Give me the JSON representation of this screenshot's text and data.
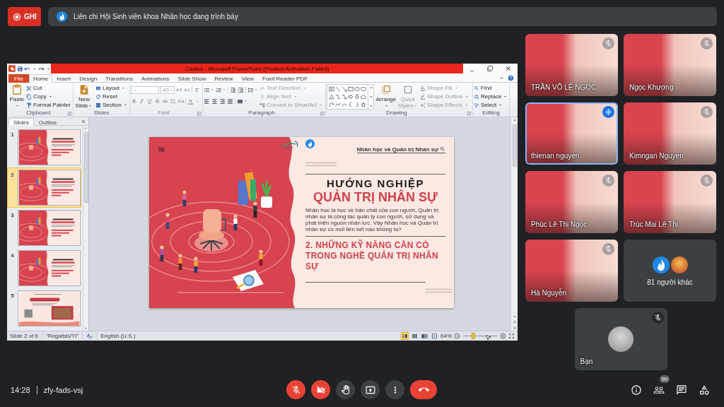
{
  "recording": {
    "label": "GHI"
  },
  "presenter_banner": {
    "text": "Liên chi Hội Sinh viên khoa Nhân học đang trình bày"
  },
  "powerpoint": {
    "title": "Cauhoi - Microsoft PowerPoint (Product Activation Failed)",
    "tabs": [
      {
        "label": "File",
        "kind": "file",
        "selected": false
      },
      {
        "label": "Home",
        "kind": "tab",
        "selected": true
      },
      {
        "label": "Insert",
        "kind": "tab",
        "selected": false
      },
      {
        "label": "Design",
        "kind": "tab",
        "selected": false
      },
      {
        "label": "Transitions",
        "kind": "tab",
        "selected": false
      },
      {
        "label": "Animations",
        "kind": "tab",
        "selected": false
      },
      {
        "label": "Slide Show",
        "kind": "tab",
        "selected": false
      },
      {
        "label": "Review",
        "kind": "tab",
        "selected": false
      },
      {
        "label": "View",
        "kind": "tab",
        "selected": false
      },
      {
        "label": "Foxit Reader PDF",
        "kind": "tab",
        "selected": false
      }
    ],
    "ribbon": {
      "groups": [
        {
          "label": "Clipboard",
          "launcher": true,
          "disabled": false,
          "columns": [
            {
              "kind": "large",
              "buttons": [
                {
                  "label": "Paste",
                  "dropdown": true,
                  "disabled": false
                }
              ]
            },
            {
              "kind": "stack",
              "buttons": [
                {
                  "label": "Cut",
                  "dropdown": false,
                  "disabled": false
                },
                {
                  "label": "Copy",
                  "dropdown": true,
                  "disabled": false
                },
                {
                  "label": "Format Painter",
                  "dropdown": false,
                  "disabled": false
                }
              ]
            }
          ]
        },
        {
          "label": "Slides",
          "launcher": false,
          "disabled": false,
          "columns": [
            {
              "kind": "large",
              "buttons": [
                {
                  "label": "New Slide",
                  "dropdown": true,
                  "disabled": false
                }
              ]
            },
            {
              "kind": "stack",
              "buttons": [
                {
                  "label": "Layout",
                  "dropdown": true,
                  "disabled": false
                },
                {
                  "label": "Reset",
                  "dropdown": false,
                  "disabled": false
                },
                {
                  "label": "Section",
                  "dropdown": true,
                  "disabled": false
                }
              ]
            }
          ]
        },
        {
          "label": "Font",
          "launcher": true,
          "disabled": true,
          "columns": [
            {
              "kind": "font",
              "size": "40"
            }
          ]
        },
        {
          "label": "Paragraph",
          "launcher": true,
          "disabled": false,
          "columns": [
            {
              "kind": "paragraph"
            },
            {
              "kind": "stack",
              "buttons": [
                {
                  "label": "Text Direction",
                  "dropdown": true,
                  "disabled": true
                },
                {
                  "label": "Align Text",
                  "dropdown": true,
                  "disabled": true
                },
                {
                  "label": "Convert to SmartArt",
                  "dropdown": true,
                  "disabled": true
                }
              ]
            }
          ]
        },
        {
          "label": "Drawing",
          "launcher": true,
          "disabled": false,
          "columns": [
            {
              "kind": "shapes"
            },
            {
              "kind": "large",
              "buttons": [
                {
                  "label": "Arrange",
                  "dropdown": true,
                  "disabled": false
                },
                {
                  "label": "Quick Styles",
                  "dropdown": true,
                  "disabled": true
                }
              ]
            },
            {
              "kind": "stack",
              "buttons": [
                {
                  "label": "Shape Fill",
                  "dropdown": true,
                  "disabled": true
                },
                {
                  "label": "Shape Outline",
                  "dropdown": true,
                  "disabled": true
                },
                {
                  "label": "Shape Effects",
                  "dropdown": true,
                  "disabled": true
                }
              ]
            }
          ]
        },
        {
          "label": "Editing",
          "launcher": false,
          "disabled": false,
          "columns": [
            {
              "kind": "stack",
              "buttons": [
                {
                  "label": "Find",
                  "dropdown": false,
                  "disabled": false
                },
                {
                  "label": "Replace",
                  "dropdown": true,
                  "disabled": false
                },
                {
                  "label": "Select",
                  "dropdown": true,
                  "disabled": false
                }
              ]
            }
          ]
        }
      ]
    },
    "slides_pane": {
      "tabs": [
        {
          "label": "Slides",
          "selected": true
        },
        {
          "label": "Outline",
          "selected": false
        }
      ],
      "thumbnails": [
        {
          "number": "1",
          "kind": "title",
          "selected": false
        },
        {
          "number": "2",
          "kind": "title",
          "selected": true
        },
        {
          "number": "3",
          "kind": "title",
          "selected": false
        },
        {
          "number": "4",
          "kind": "title",
          "selected": false
        },
        {
          "number": "5",
          "kind": "speaker",
          "selected": false
        }
      ]
    },
    "slide": {
      "topic": "Nhân học và Quản trị Nhân sự",
      "title": "HƯỚNG NGHIỆP",
      "subtitle": "QUẢN TRỊ NHÂN SỰ",
      "intro": "Nhân học là học về bản chất của con người, Quản trị nhân sự là công tác quản lý con người, sử dụng và phát triển nguồn nhân lực. Vậy Nhân học và Quản trị nhân sự có mối liên kết nào không ta?",
      "section": "2. NHỮNG KỸ NĂNG CẦN CÓ TRONG NGHỀ QUẢN TRỊ NHÂN SỰ"
    },
    "status_bar": {
      "slide_position": "Slide 2 of 6",
      "theme": "\"RegattaVTI\"",
      "language": "English (U.S.)",
      "views": [
        {
          "selected": true
        },
        {
          "selected": false
        },
        {
          "selected": false
        },
        {
          "selected": false
        }
      ],
      "zoom": {
        "reading": "64%",
        "level": 0.3
      }
    }
  },
  "participants": [
    {
      "name": "TRẦN VÕ LÊ NGỌC",
      "muted": true,
      "speaking": false
    },
    {
      "name": "Ngọc Khương",
      "muted": true,
      "speaking": false
    },
    {
      "name": "thienan nguyen",
      "muted": false,
      "speaking": true
    },
    {
      "name": "Kimngan Nguyen",
      "muted": true,
      "speaking": false
    },
    {
      "name": "Phúc Lê Thị Ngọc",
      "muted": true,
      "speaking": false
    },
    {
      "name": "Trúc Mai Lê Thị",
      "muted": true,
      "speaking": false
    },
    {
      "name": "Hà Nguyễn",
      "muted": true,
      "speaking": false
    }
  ],
  "others": {
    "label": "81 người khác"
  },
  "self": {
    "name": "Bạn",
    "muted": true
  },
  "meeting": {
    "time": "14:28",
    "code": "zfy-fads-vsj"
  },
  "call_controls": {
    "microphone_on": false,
    "camera_on": false,
    "hand_raised": false,
    "presenting": false
  },
  "people_badge": "90"
}
